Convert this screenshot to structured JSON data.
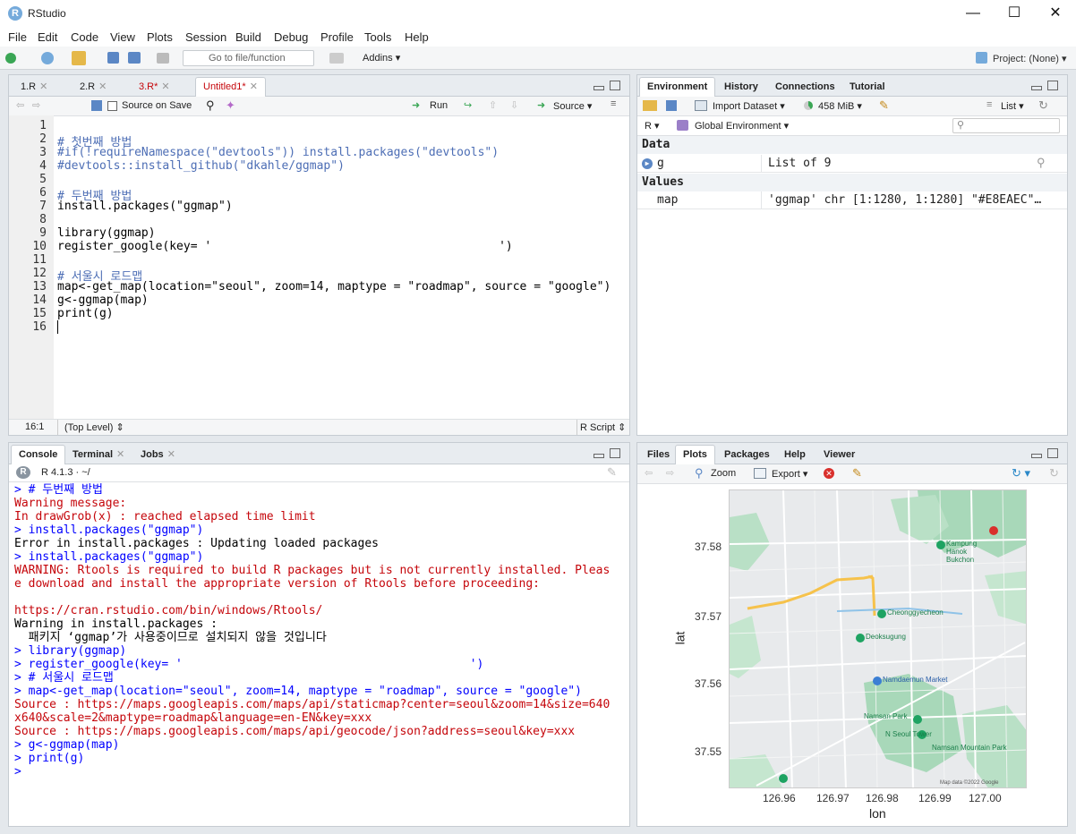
{
  "app": {
    "title": "RStudio",
    "logo": "R"
  },
  "menu": [
    "File",
    "Edit",
    "Code",
    "View",
    "Plots",
    "Session",
    "Build",
    "Debug",
    "Profile",
    "Tools",
    "Help"
  ],
  "toolbar": {
    "goto_placeholder": "Go to file/function",
    "addins": "Addins",
    "project": "Project: (None)"
  },
  "editor": {
    "tabs": [
      {
        "label": "1.R",
        "active": false
      },
      {
        "label": "2.R",
        "active": false
      },
      {
        "label": "3.R*",
        "active": false
      },
      {
        "label": "Untitled1*",
        "active": true
      }
    ],
    "source_on_save": "Source on Save",
    "run": "Run",
    "source": "Source",
    "lines": [
      "",
      "# 첫번째 방법",
      "#if(!requireNamespace(\"devtools\")) install.packages(\"devtools\")",
      "#devtools::install_github(\"dkahle/ggmap\")",
      "",
      "# 두번째 방법",
      "install.packages(\"ggmap\")",
      "",
      "library(ggmap)",
      "register_google(key= '                                         ')",
      "",
      "# 서울시 로드맵",
      "map<-get_map(location=\"seoul\", zoom=14, maptype = \"roadmap\", source = \"google\")",
      "g<-ggmap(map)",
      "print(g)",
      ""
    ],
    "status_pos": "16:1",
    "status_scope": "(Top Level)",
    "status_type": "R Script"
  },
  "console": {
    "tabs": [
      "Console",
      "Terminal",
      "Jobs"
    ],
    "header": "R 4.1.3 · ~/",
    "lines": [
      {
        "t": "> # 두번째 방법",
        "c": "blue"
      },
      {
        "t": "Warning message:",
        "c": "red"
      },
      {
        "t": "In drawGrob(x) : reached elapsed time limit",
        "c": "red"
      },
      {
        "t": "> install.packages(\"ggmap\")",
        "c": "blue"
      },
      {
        "t": "Error in install.packages : Updating loaded packages",
        "c": "blk"
      },
      {
        "t": "> install.packages(\"ggmap\")",
        "c": "blue"
      },
      {
        "t": "WARNING: Rtools is required to build R packages but is not currently installed. Pleas",
        "c": "red"
      },
      {
        "t": "e download and install the appropriate version of Rtools before proceeding:",
        "c": "red"
      },
      {
        "t": "",
        "c": "blk"
      },
      {
        "t": "https://cran.rstudio.com/bin/windows/Rtools/",
        "c": "red"
      },
      {
        "t": "Warning in install.packages :",
        "c": "blk"
      },
      {
        "t": "  패키지 ‘ggmap’가 사용중이므로 설치되지 않을 것입니다",
        "c": "blk"
      },
      {
        "t": "> library(ggmap)",
        "c": "blue"
      },
      {
        "t": "> register_google(key= '                                         ')",
        "c": "blue"
      },
      {
        "t": "> # 서울시 로드맵",
        "c": "blue"
      },
      {
        "t": "> map<-get_map(location=\"seoul\", zoom=14, maptype = \"roadmap\", source = \"google\")",
        "c": "blue"
      },
      {
        "t": "Source : https://maps.googleapis.com/maps/api/staticmap?center=seoul&zoom=14&size=640",
        "c": "red"
      },
      {
        "t": "x640&scale=2&maptype=roadmap&language=en-EN&key=xxx",
        "c": "red"
      },
      {
        "t": "Source : https://maps.googleapis.com/maps/api/geocode/json?address=seoul&key=xxx",
        "c": "red"
      },
      {
        "t": "> g<-ggmap(map)",
        "c": "blue"
      },
      {
        "t": "> print(g)",
        "c": "blue"
      },
      {
        "t": "> ",
        "c": "blue"
      }
    ]
  },
  "environment": {
    "tabs": [
      "Environment",
      "History",
      "Connections",
      "Tutorial"
    ],
    "import": "Import Dataset",
    "memory": "458 MiB",
    "list": "List",
    "lang": "R",
    "scope": "Global Environment",
    "data_header": "Data",
    "values_header": "Values",
    "data_rows": [
      {
        "name": "g",
        "value": "List of  9"
      }
    ],
    "value_rows": [
      {
        "name": "map",
        "value": "'ggmap' chr [1:1280, 1:1280] \"#E8EAEC\"…"
      }
    ]
  },
  "plots": {
    "tabs": [
      "Files",
      "Plots",
      "Packages",
      "Help",
      "Viewer"
    ],
    "zoom": "Zoom",
    "export": "Export",
    "xlabel": "lon",
    "ylabel": "lat",
    "xticks": [
      "126.96",
      "126.97",
      "126.98",
      "126.99",
      "127.00"
    ],
    "yticks": [
      "37.58",
      "37.57",
      "37.56",
      "37.55"
    ],
    "map_labels": [
      "Cheonggyecheon",
      "Deoksugung",
      "Namdaemun Market",
      "Namsan Park",
      "N Seoul Tower",
      "Namsan Mountain Park",
      "Kampung Hanok Bukchon"
    ],
    "copyright": "Map data ©2022 Google"
  }
}
